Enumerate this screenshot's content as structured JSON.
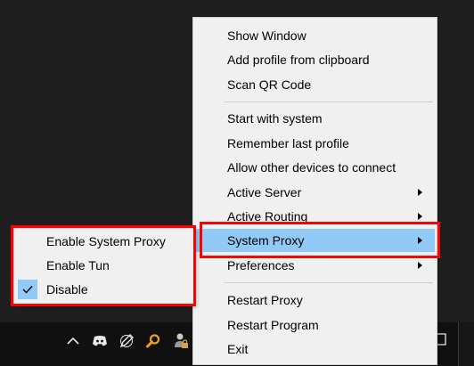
{
  "main_menu": {
    "items": [
      {
        "label": "Show Window",
        "submenu": false,
        "highlighted": false
      },
      {
        "label": "Add profile from clipboard",
        "submenu": false,
        "highlighted": false
      },
      {
        "label": "Scan QR Code",
        "submenu": false,
        "highlighted": false
      },
      {
        "label": "Start with system",
        "submenu": false,
        "highlighted": false
      },
      {
        "label": "Remember last profile",
        "submenu": false,
        "highlighted": false
      },
      {
        "label": "Allow other devices to connect",
        "submenu": false,
        "highlighted": false
      },
      {
        "label": "Active Server",
        "submenu": true,
        "highlighted": false
      },
      {
        "label": "Active Routing",
        "submenu": true,
        "highlighted": false
      },
      {
        "label": "System Proxy",
        "submenu": true,
        "highlighted": true
      },
      {
        "label": "Preferences",
        "submenu": true,
        "highlighted": false
      },
      {
        "label": "Restart Proxy",
        "submenu": false,
        "highlighted": false
      },
      {
        "label": "Restart Program",
        "submenu": false,
        "highlighted": false
      },
      {
        "label": "Exit",
        "submenu": false,
        "highlighted": false
      }
    ]
  },
  "proxy_submenu": {
    "items": [
      {
        "label": "Enable System Proxy",
        "checked": false
      },
      {
        "label": "Enable Tun",
        "checked": false
      },
      {
        "label": "Disable",
        "checked": true
      }
    ]
  },
  "tray": {
    "icons": [
      "chevron-up-icon",
      "discord-icon",
      "pen-icon",
      "magnifier-icon",
      "user-lock-icon",
      "notification-icon"
    ]
  },
  "colors": {
    "menu_background": "#f0f0f0",
    "highlight": "#91c9f7",
    "annotation": "#ff0000",
    "taskbar": "#101010"
  }
}
